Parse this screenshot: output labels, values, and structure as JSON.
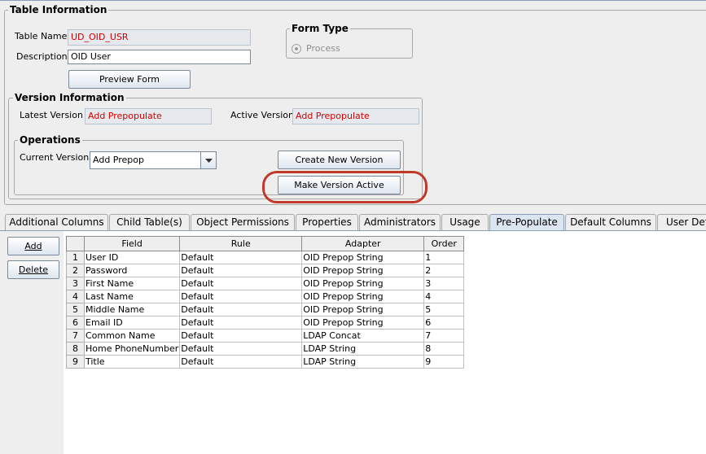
{
  "table_info": {
    "legend": "Table Information",
    "table_name_label": "Table Name",
    "table_name_value": "UD_OID_USR",
    "description_label": "Description",
    "description_value": "OID User",
    "preview_button": "Preview Form"
  },
  "form_type": {
    "legend": "Form Type",
    "radio_label": "Process"
  },
  "version_info": {
    "legend": "Version Information",
    "latest_label": "Latest Version",
    "latest_value": "Add Prepopulate",
    "active_label": "Active Version",
    "active_value": "Add Prepopulate"
  },
  "operations": {
    "legend": "Operations",
    "current_label": "Current Version",
    "current_value": "Add Prepop",
    "create_button": "Create New Version",
    "make_active_button": "Make Version Active"
  },
  "highlight_color": "#c0392b",
  "tabs": [
    {
      "label": "Additional Columns",
      "active": false
    },
    {
      "label": "Child Table(s)",
      "active": false
    },
    {
      "label": "Object Permissions",
      "active": false
    },
    {
      "label": "Properties",
      "active": false
    },
    {
      "label": "Administrators",
      "active": false
    },
    {
      "label": "Usage",
      "active": false
    },
    {
      "label": "Pre-Populate",
      "active": true
    },
    {
      "label": "Default Columns",
      "active": false
    },
    {
      "label": "User Def",
      "active": false
    }
  ],
  "side_buttons": {
    "add": "Add",
    "delete": "Delete"
  },
  "grid": {
    "columns": [
      "",
      "Field",
      "Rule",
      "Adapter",
      "Order"
    ],
    "rows": [
      [
        "1",
        "User ID",
        "Default",
        "OID Prepop String",
        "1"
      ],
      [
        "2",
        "Password",
        "Default",
        "OID Prepop String",
        "2"
      ],
      [
        "3",
        "First Name",
        "Default",
        "OID Prepop String",
        "3"
      ],
      [
        "4",
        "Last Name",
        "Default",
        "OID Prepop String",
        "4"
      ],
      [
        "5",
        "Middle Name",
        "Default",
        "OID Prepop String",
        "5"
      ],
      [
        "6",
        "Email ID",
        "Default",
        "OID Prepop String",
        "6"
      ],
      [
        "7",
        "Common Name",
        "Default",
        "LDAP Concat",
        "7"
      ],
      [
        "8",
        "Home PhoneNumber",
        "Default",
        "LDAP String",
        "8"
      ],
      [
        "9",
        "Title",
        "Default",
        "LDAP String",
        "9"
      ]
    ]
  }
}
